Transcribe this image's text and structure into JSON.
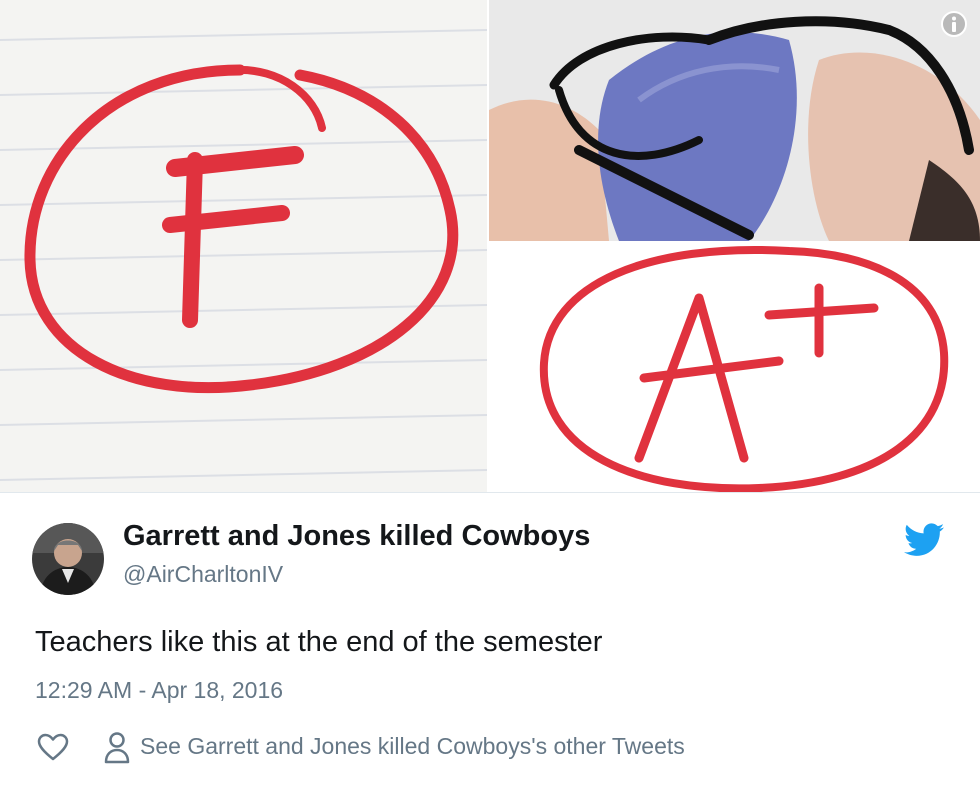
{
  "tweet": {
    "display_name": "Garrett and Jones killed Cowboys",
    "handle": "@AirCharltonIV",
    "text": "Teachers like this at the end of the semester",
    "timestamp": "12:29 AM - Apr 18, 2016",
    "other_tweets_link": "See Garrett and Jones killed Cowboys's other Tweets"
  },
  "media": {
    "left_image_grade": "F",
    "bottom_right_image_grade": "A+"
  },
  "icons": {
    "info": "info-icon",
    "brand": "twitter-bird-icon",
    "like": "heart-icon",
    "profile": "user-icon"
  },
  "colors": {
    "twitter_blue": "#1da1f2",
    "grade_red": "#e0323e",
    "secondary_text": "#657786"
  }
}
